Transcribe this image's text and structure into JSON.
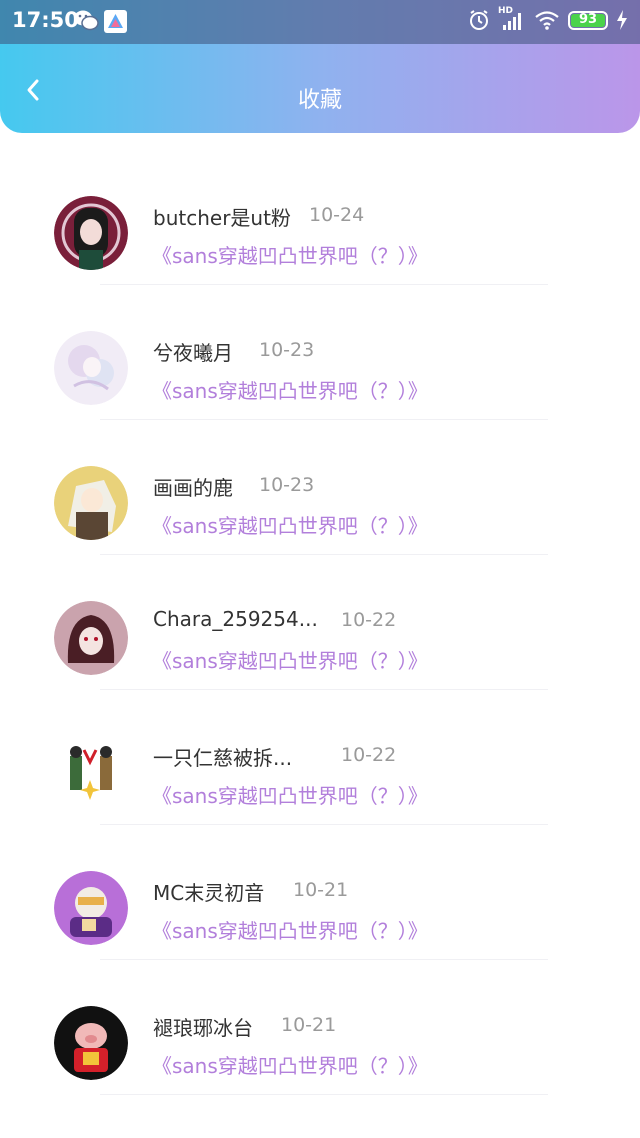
{
  "status_bar": {
    "time": "17:50",
    "battery": "93",
    "network": "HD"
  },
  "header": {
    "title": "收藏"
  },
  "colors": {
    "gradient_start": "#45c9ef",
    "gradient_end": "#bb96e9",
    "post_link": "#b27fdb"
  },
  "favorites": [
    {
      "name": "butcher是ut粉",
      "date": "10-24",
      "post": "《sans穿越凹凸世界吧（？）》",
      "avatar": "avatar-dark-anime"
    },
    {
      "name": "兮夜曦月",
      "date": "10-23",
      "post": "《sans穿越凹凸世界吧（？）》",
      "avatar": "avatar-pastel-anime"
    },
    {
      "name": "画画的鹿",
      "date": "10-23",
      "post": "《sans穿越凹凸世界吧（？）》",
      "avatar": "avatar-yellow-anime"
    },
    {
      "name": "Chara_259254...",
      "date": "10-22",
      "post": "《sans穿越凹凸世界吧（？）》",
      "avatar": "avatar-red-anime"
    },
    {
      "name": "一只仁慈被拆...",
      "date": "10-22",
      "post": "《sans穿越凹凸世界吧（？）》",
      "avatar": "avatar-two-figures"
    },
    {
      "name": "MC末灵初音",
      "date": "10-21",
      "post": "《sans穿越凹凸世界吧（？）》",
      "avatar": "avatar-purple-robot"
    },
    {
      "name": "褪琅琊冰台",
      "date": "10-21",
      "post": "《sans穿越凹凸世界吧（？）》",
      "avatar": "avatar-pig"
    }
  ]
}
